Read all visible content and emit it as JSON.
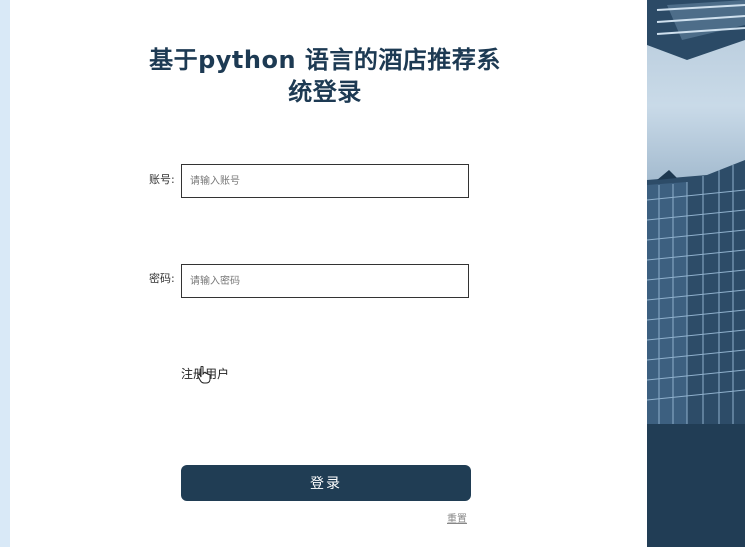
{
  "page": {
    "title": "基于python 语言的酒店推荐系统登录"
  },
  "form": {
    "account_label": "账号:",
    "account_placeholder": "请输入账号",
    "password_label": "密码:",
    "password_placeholder": "请输入密码",
    "register_link": "注册用户",
    "login_button": "登录",
    "reset_link": "重置"
  },
  "colors": {
    "primary": "#203d54",
    "left_strip": "#d9e9f7"
  }
}
